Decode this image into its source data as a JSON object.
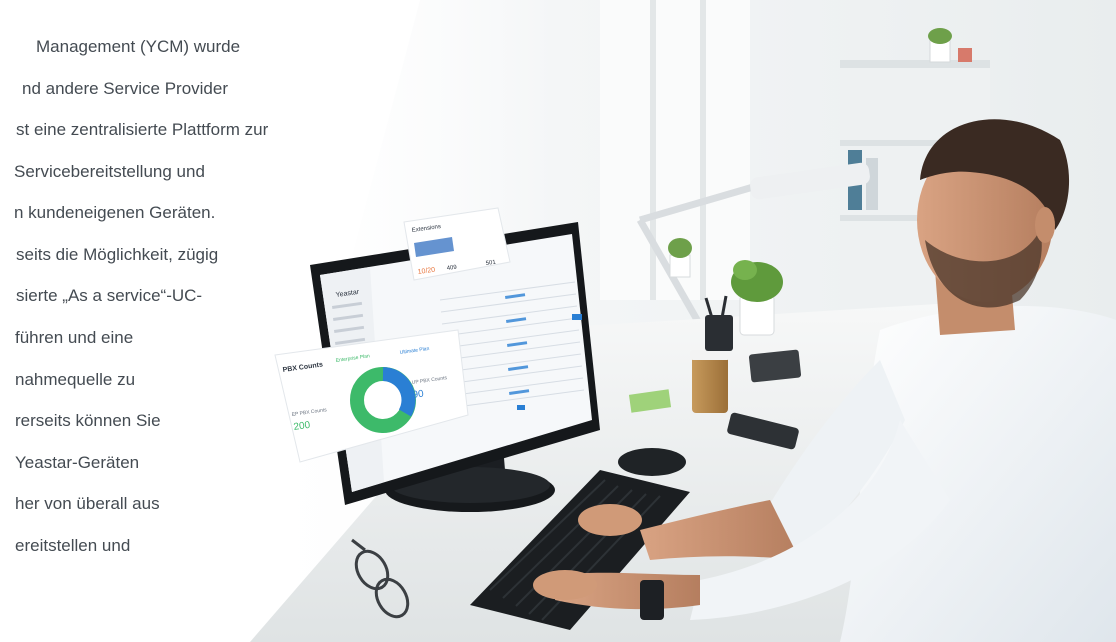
{
  "intro_text": {
    "lines": [
      "Management (YCM) wurde",
      "nd andere Service Provider",
      "st eine zentralisierte Plattform zur",
      "Servicebereitstellung und",
      "n kundeneigenen Geräten.",
      "seits die Möglichkeit, zügig",
      "sierte „As a service“-UC-",
      "führen und eine",
      "nahmequelle zu",
      "rerseits können Sie",
      "Yeastar-Geräten",
      "her von überall aus",
      "ereitstellen und"
    ]
  },
  "monitor": {
    "app_name": "Yeastar",
    "chart_card_title": "PBX Counts",
    "legend_enterprise": "Enterprise Plan",
    "legend_ultimate": "Ultimate Plan",
    "stat_left_label": "EP PBX Counts",
    "stat_left_value": "200",
    "stat_right_label": "UP PBX Counts",
    "stat_right_value": "90",
    "top_card_title": "Extensions",
    "top_card_v1": "10/20",
    "top_card_v2": "409",
    "top_card_v3": "501"
  },
  "colors": {
    "donut_blue": "#2a7fd4",
    "donut_green": "#3dba6a",
    "accent_orange": "#e8743b",
    "text_gray": "#444b52"
  }
}
